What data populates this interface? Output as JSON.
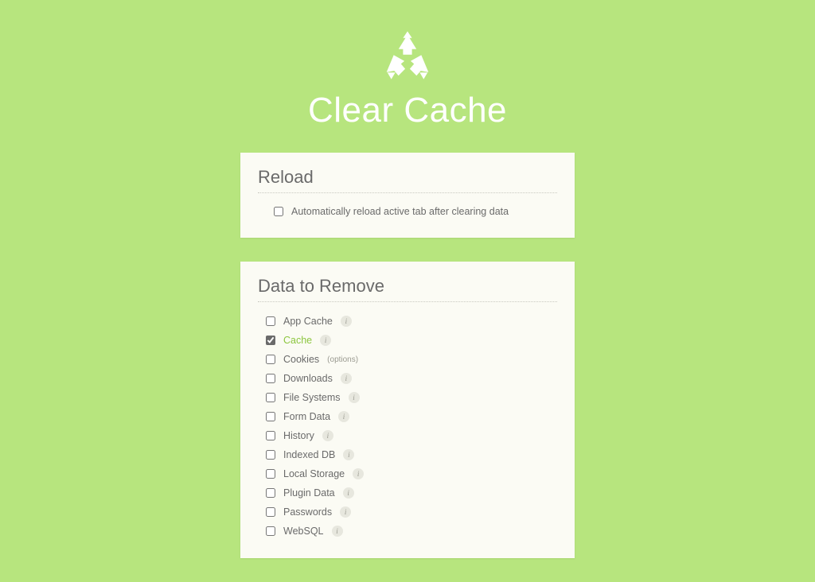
{
  "header": {
    "title": "Clear Cache"
  },
  "reload": {
    "heading": "Reload",
    "auto_reload": {
      "label": "Automatically reload active tab after clearing data",
      "checked": false
    }
  },
  "data_to_remove": {
    "heading": "Data to Remove",
    "options_text": "(options)",
    "info_glyph": "i",
    "items": [
      {
        "label": "App Cache",
        "checked": false,
        "has_info": true,
        "has_options": false
      },
      {
        "label": "Cache",
        "checked": true,
        "has_info": true,
        "has_options": false
      },
      {
        "label": "Cookies",
        "checked": false,
        "has_info": false,
        "has_options": true
      },
      {
        "label": "Downloads",
        "checked": false,
        "has_info": true,
        "has_options": false
      },
      {
        "label": "File Systems",
        "checked": false,
        "has_info": true,
        "has_options": false
      },
      {
        "label": "Form Data",
        "checked": false,
        "has_info": true,
        "has_options": false
      },
      {
        "label": "History",
        "checked": false,
        "has_info": true,
        "has_options": false
      },
      {
        "label": "Indexed DB",
        "checked": false,
        "has_info": true,
        "has_options": false
      },
      {
        "label": "Local Storage",
        "checked": false,
        "has_info": true,
        "has_options": false
      },
      {
        "label": "Plugin Data",
        "checked": false,
        "has_info": true,
        "has_options": false
      },
      {
        "label": "Passwords",
        "checked": false,
        "has_info": true,
        "has_options": false
      },
      {
        "label": "WebSQL",
        "checked": false,
        "has_info": true,
        "has_options": false
      }
    ]
  }
}
